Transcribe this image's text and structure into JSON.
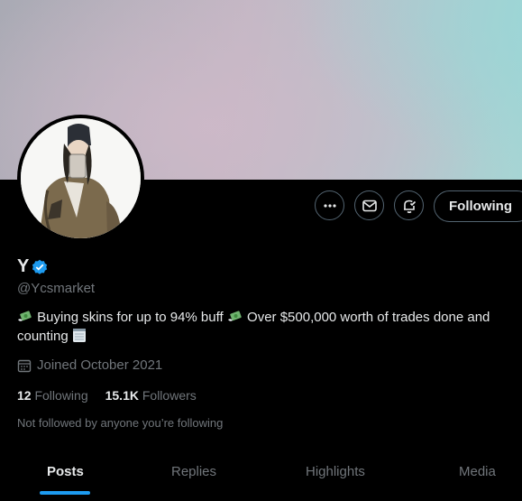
{
  "profile": {
    "name": "Y",
    "handle": "@Ycsmarket",
    "bio_part1": "Buying skins for up to 94% buff",
    "bio_part2": "Over $500,000 worth of trades done and counting",
    "joined": "Joined October 2021",
    "following_count": "12",
    "following_label": "Following",
    "followers_count": "15.1K",
    "followers_label": "Followers",
    "not_followed": "Not followed by anyone you’re following"
  },
  "actions": {
    "follow_label": "Following"
  },
  "tabs": [
    {
      "label": "Posts",
      "active": true
    },
    {
      "label": "Replies",
      "active": false
    },
    {
      "label": "Highlights",
      "active": false
    },
    {
      "label": "Media",
      "active": false
    }
  ],
  "colors": {
    "accent": "#1d9bf0",
    "muted": "#71767b",
    "text": "#e7e9ea",
    "background": "#000000"
  }
}
